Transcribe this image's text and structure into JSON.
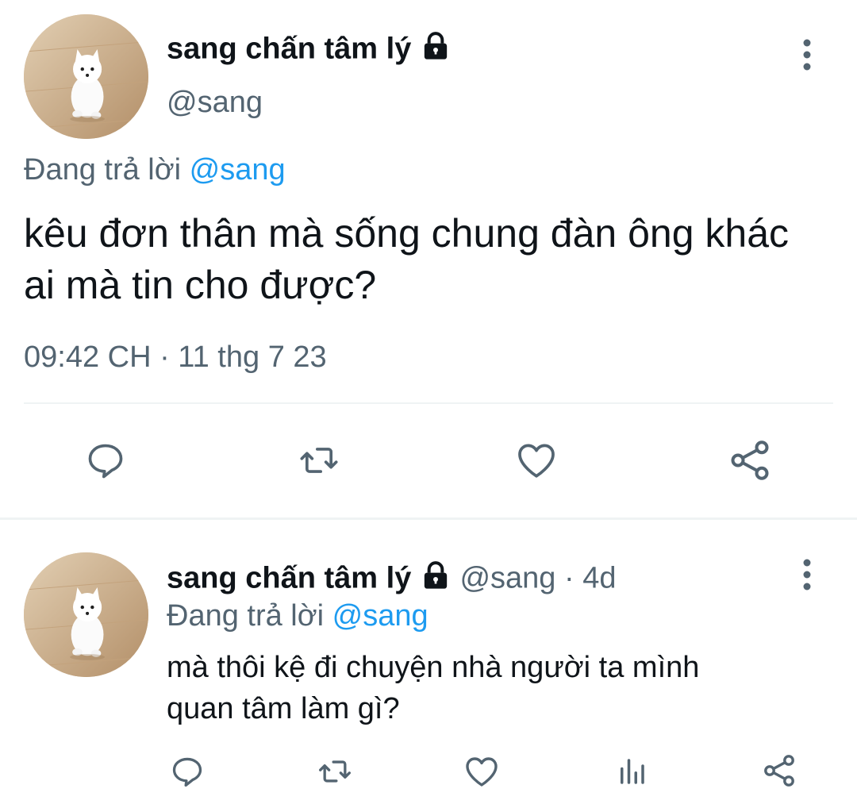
{
  "colors": {
    "text": "#0f1419",
    "secondary": "#536471",
    "accent": "#1d9bf0",
    "divider": "#eff3f4"
  },
  "main_tweet": {
    "author_name": "sang chấn tâm lý",
    "author_handle": "@sang",
    "locked_icon": "lock-icon",
    "more_icon": "more-vertical-icon",
    "replying_prefix": "Đang trả lời",
    "replying_to": "@sang",
    "text_lines": [
      "kêu đơn thân mà sống chung đàn ông khác",
      "ai mà tin cho được?"
    ],
    "timestamp": "09:42 CH · 11 thg 7 23",
    "actions": [
      "reply-icon",
      "retweet-icon",
      "like-icon",
      "share-icon"
    ]
  },
  "reply_tweet": {
    "author_name": "sang chấn tâm lý",
    "author_handle": "@sang",
    "time_ago": "· 4d",
    "locked_icon": "lock-icon",
    "more_icon": "more-vertical-icon",
    "replying_prefix": "Đang trả lời",
    "replying_to": "@sang",
    "text_lines": [
      "mà thôi kệ đi chuyện nhà người ta mình",
      "quan tâm làm gì?"
    ],
    "actions": [
      "reply-icon",
      "retweet-icon",
      "like-icon",
      "views-icon",
      "share-icon"
    ]
  }
}
